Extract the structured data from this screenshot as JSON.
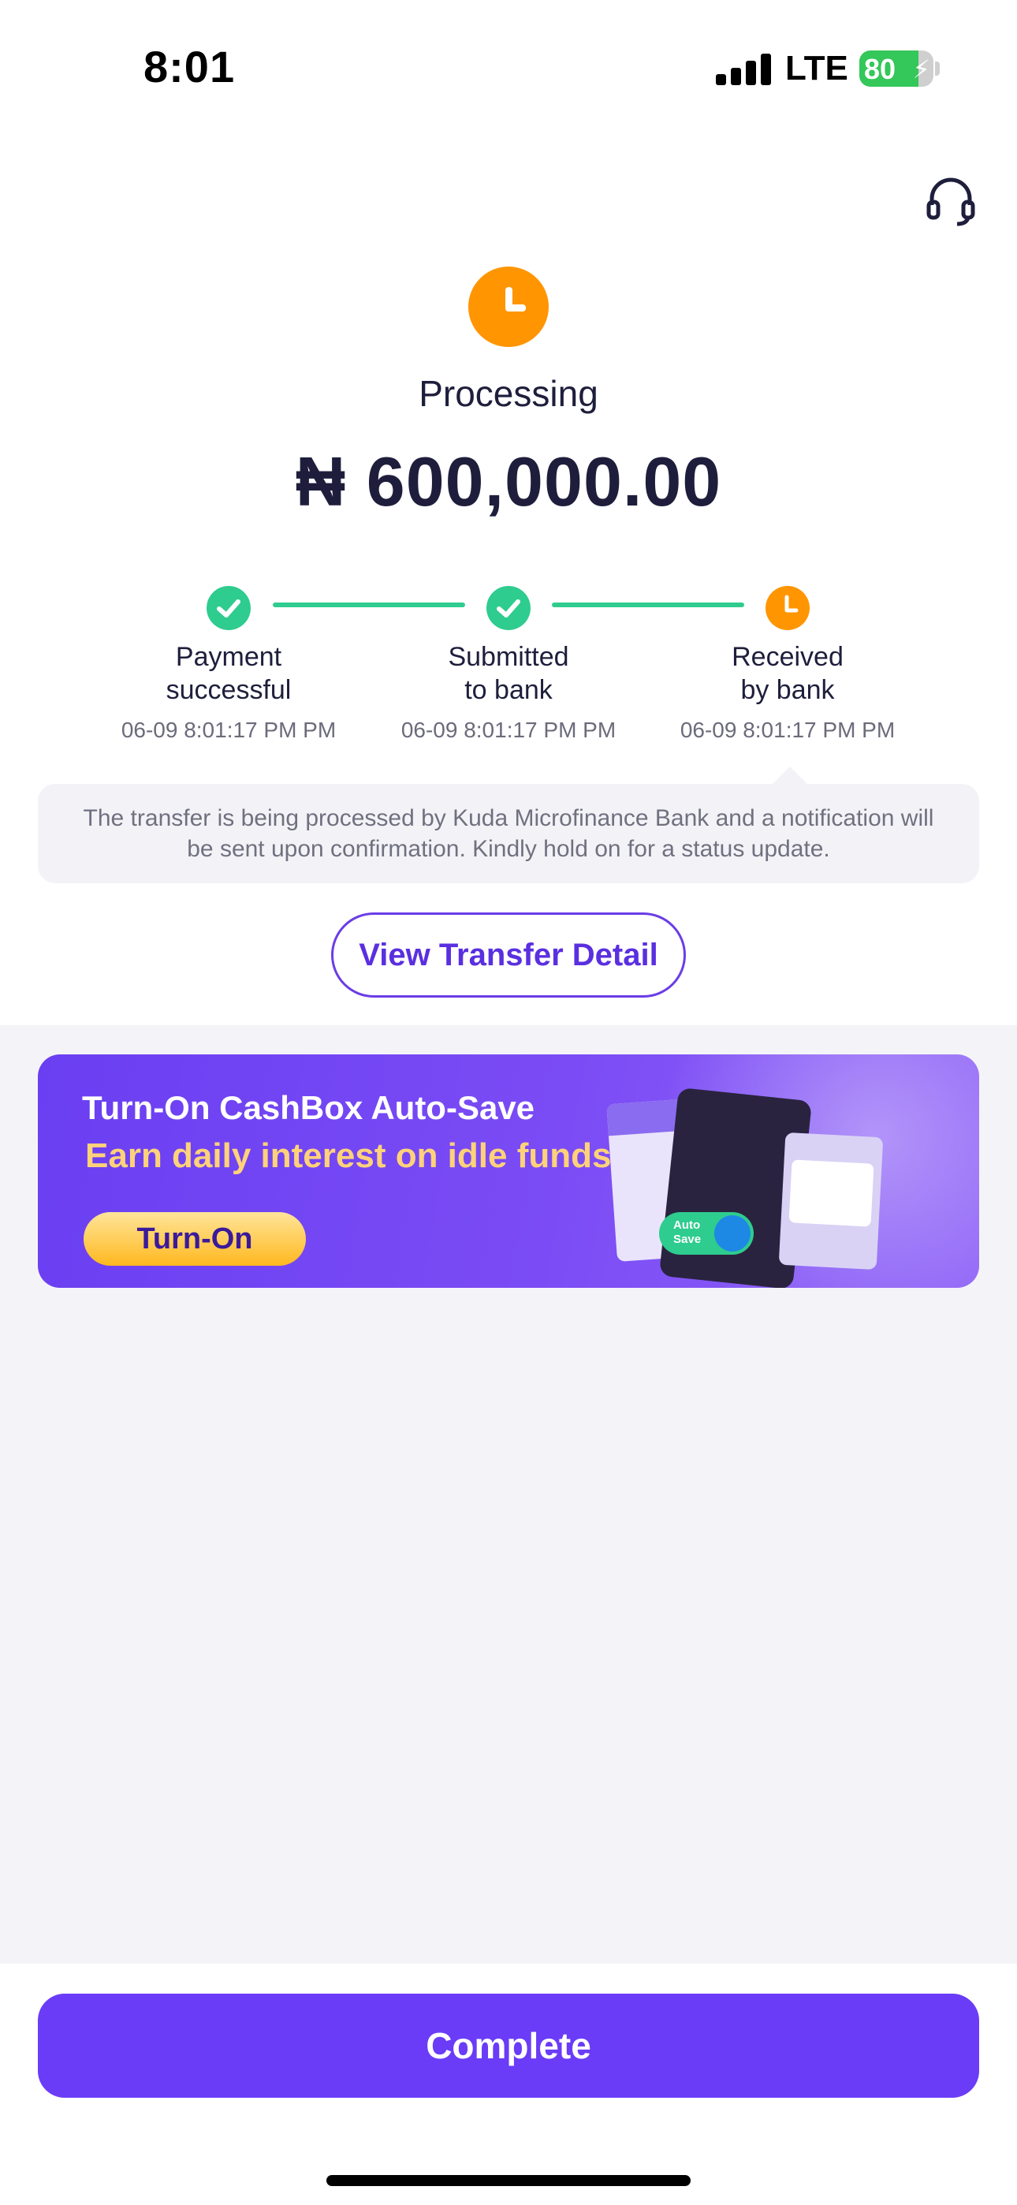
{
  "status_bar": {
    "time": "8:01",
    "network": "LTE",
    "battery": "80",
    "battery_level": 0.8
  },
  "header": {
    "support_icon": "headset-icon"
  },
  "transfer": {
    "status": "Processing",
    "amount": "₦ 600,000.00",
    "status_color": "#ff9500"
  },
  "steps": [
    {
      "line1": "Payment",
      "line2": "successful",
      "time": "06-09 8:01:17 PM PM",
      "state": "done"
    },
    {
      "line1": "Submitted",
      "line2": "to bank",
      "time": "06-09 8:01:17 PM PM",
      "state": "done"
    },
    {
      "line1": "Received",
      "line2": "by bank",
      "time": "06-09 8:01:17 PM PM",
      "state": "pending"
    }
  ],
  "note": "The transfer is being processed by Kuda Microfinance Bank and a notification will be sent upon confirmation. Kindly hold on for a status update.",
  "detail_button": "View Transfer Detail",
  "banner": {
    "title": "Turn-On CashBox Auto-Save",
    "subtitle": "Earn daily interest on idle funds",
    "cta": "Turn-On",
    "toggle_label_1": "Auto",
    "toggle_label_2": "Save"
  },
  "complete_button": "Complete",
  "colors": {
    "accent": "#6a3cf7",
    "success": "#2ecc8e",
    "pending": "#ff9500"
  }
}
